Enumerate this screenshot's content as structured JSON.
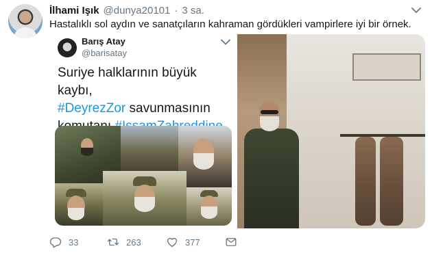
{
  "tweet": {
    "author_name": "İlhami Işık",
    "handle": "@dunya20101",
    "separator": "·",
    "time": "3 sa.",
    "text": "Hastalıklı sol aydın ve sanatçıların kahraman gördükleri vampirlere iyi bir örnek."
  },
  "embedded": {
    "author_name": "Barış Atay",
    "handle": "@barisatay",
    "line1": "Suriye halklarının büyük kaybı,",
    "line2_hashtag": "#DeyrezZor",
    "line2_rest": " savunmasının",
    "line3_text": "komutanı ",
    "line3_hashtag": "#IssamZahreddine",
    "hashtag_color": "#1b95e0"
  },
  "actions": {
    "reply_count": "33",
    "retweet_count": "263",
    "like_count": "377",
    "icons": [
      "reply-icon",
      "retweet-icon",
      "like-icon",
      "direct-message-icon"
    ]
  },
  "colors": {
    "text_primary": "#14171a",
    "text_secondary": "#657786",
    "link": "#1b95e0"
  }
}
